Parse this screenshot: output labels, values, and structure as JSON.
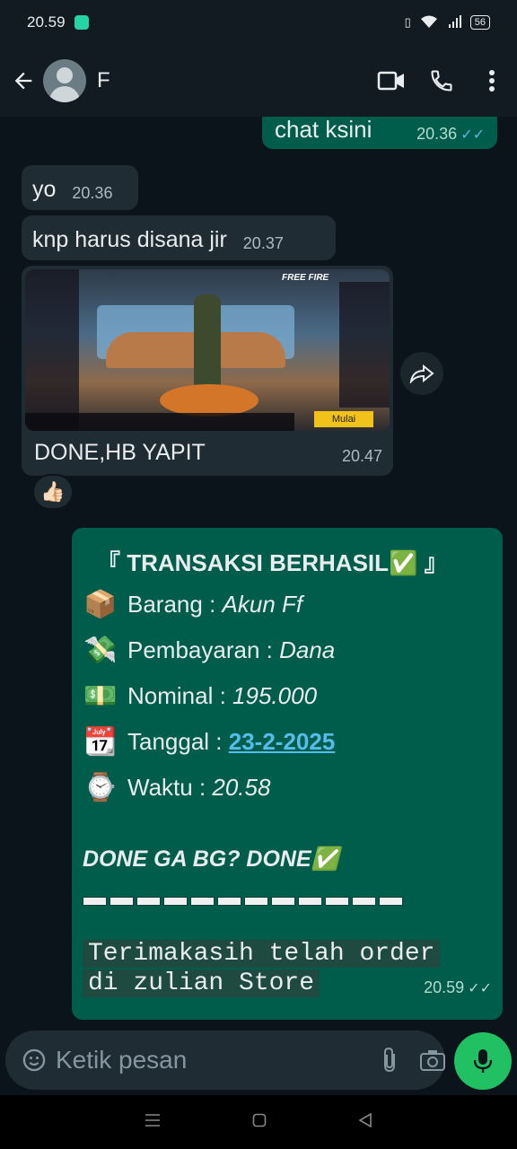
{
  "status_bar": {
    "time": "20.59",
    "battery": "56"
  },
  "header": {
    "contact_name": "F"
  },
  "messages": {
    "m1": {
      "text": "chat ksini",
      "time": "20.36"
    },
    "m2": {
      "text": "yo",
      "time": "20.36"
    },
    "m3": {
      "text": "knp harus disana jir",
      "time": "20.37"
    },
    "m4": {
      "caption": "DONE,HB YAPIT",
      "time": "20.47",
      "reaction": "👍🏻",
      "image": {
        "brand": "FREE FIRE",
        "start_button": "Mulai"
      }
    },
    "m5": {
      "title": "『 TRANSAKSI BERHASIL✅ 』",
      "rows": [
        {
          "emoji": "📦",
          "label": "Barang : ",
          "value": "Akun Ff"
        },
        {
          "emoji": "💸",
          "label": "Pembayaran : ",
          "value": "Dana"
        },
        {
          "emoji": "💵",
          "label": "Nominal : ",
          "value": "195.000"
        },
        {
          "emoji": "📆",
          "label": "Tanggal : ",
          "value": "23-2-2025"
        },
        {
          "emoji": "⌚",
          "label": "Waktu : ",
          "value": "20.58"
        }
      ],
      "done_line": "DONE GA BG? DONE✅",
      "thanks_1": "Terimakasih telah order",
      "thanks_2": "di zulian Store",
      "time": "20.59"
    }
  },
  "input": {
    "placeholder": "Ketik pesan"
  },
  "colors": {
    "outgoing": "#005c4b",
    "incoming": "#202c33",
    "accent": "#21c063",
    "link": "#53bdeb"
  }
}
